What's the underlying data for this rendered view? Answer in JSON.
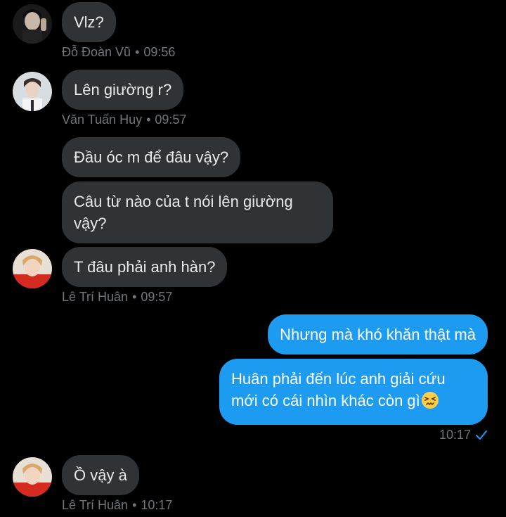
{
  "messages": [
    {
      "text": "Vlz?",
      "sender": "Đỗ Đoàn Vũ",
      "time": "09:56"
    },
    {
      "text": "Lên giường r?",
      "sender": "Văn Tuấn Huy",
      "time": "09:57"
    },
    {
      "text": "Đầu óc m để đâu vậy?"
    },
    {
      "text_line1": "Câu từ nào của t nói lên giường",
      "text_line2": "vậy?"
    },
    {
      "text": "T đâu phải anh hàn?",
      "sender": "Lê Trí Huân",
      "time": "09:57"
    },
    {
      "text": "Nhưng mà khó khăn thật mà"
    },
    {
      "text_line1": "Huân phải đến lúc anh giải cứu",
      "text_line2": "mới có cái nhìn khác còn gì",
      "emoji": "persevering-face",
      "time": "10:17"
    },
    {
      "text": "Ồ vậy à",
      "sender": "Lê Trí Huân",
      "time": "10:17"
    }
  ],
  "separator": "•",
  "colors": {
    "background": "#000000",
    "incoming_bubble": "#2f3336",
    "outgoing_bubble": "#1d9bf0",
    "meta_text": "#71767b",
    "read_check": "#1d9bf0"
  },
  "icons": {
    "read_receipt": "check-icon"
  }
}
